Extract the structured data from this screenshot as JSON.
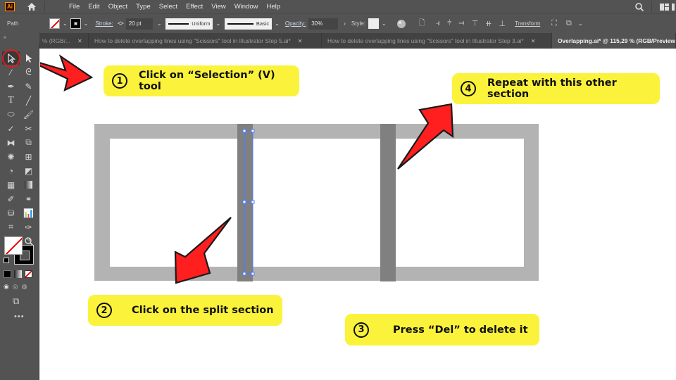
{
  "app": {
    "logo": "Ai",
    "name": "Adobe Illustrator"
  },
  "menu": {
    "items": [
      "File",
      "Edit",
      "Object",
      "Type",
      "Select",
      "Effect",
      "View",
      "Window",
      "Help"
    ]
  },
  "control_bar": {
    "object_type": "Path",
    "stroke_label": "Stroke:",
    "stroke_weight": "20 pt",
    "variable_width_profile": "Uniform",
    "brush_definition": "Basic",
    "opacity_label": "Opacity:",
    "opacity_value": "30%",
    "style_label": "Style:",
    "transform_label": "Transform"
  },
  "tabs": [
    {
      "label": "% (RGB/...",
      "active": false
    },
    {
      "label": "How to delete overlapping lines using \"Scissors\" tool in Illustrator Step 5.ai*",
      "active": false
    },
    {
      "label": "How to delete overlapping lines using \"Scissors\" tool in Illustrator Step 3.ai*",
      "active": false
    },
    {
      "label": "Overlapping.ai* @ 115,29 % (RGB/Preview",
      "active": true
    }
  ],
  "tools": [
    "selection",
    "direct-selection",
    "magic-wand",
    "lasso",
    "pen",
    "curvature",
    "type",
    "line",
    "ellipse",
    "paintbrush",
    "shaper",
    "scissors",
    "width",
    "free-transform",
    "puppet-warp",
    "perspective",
    "shape-builder",
    "gradient-mesh",
    "mesh",
    "gradient",
    "eyedropper",
    "blend",
    "symbol-sprayer",
    "column-graph",
    "artboard",
    "slice",
    "hand",
    "zoom"
  ],
  "annotations": [
    {
      "number": "①",
      "text": "Click on “Selection” (V) tool"
    },
    {
      "number": "②",
      "text": "Click on the split section"
    },
    {
      "number": "③",
      "text": "Press “Del” to delete it"
    },
    {
      "number": "④",
      "text": "Repeat with this other section"
    }
  ],
  "colors": {
    "callout": "#fbf33b",
    "arrow": "#ff1f1f",
    "frame": "#b3b3b3",
    "split_bar": "#808080",
    "selection": "#4d7cff",
    "ui_bg": "#535353"
  }
}
